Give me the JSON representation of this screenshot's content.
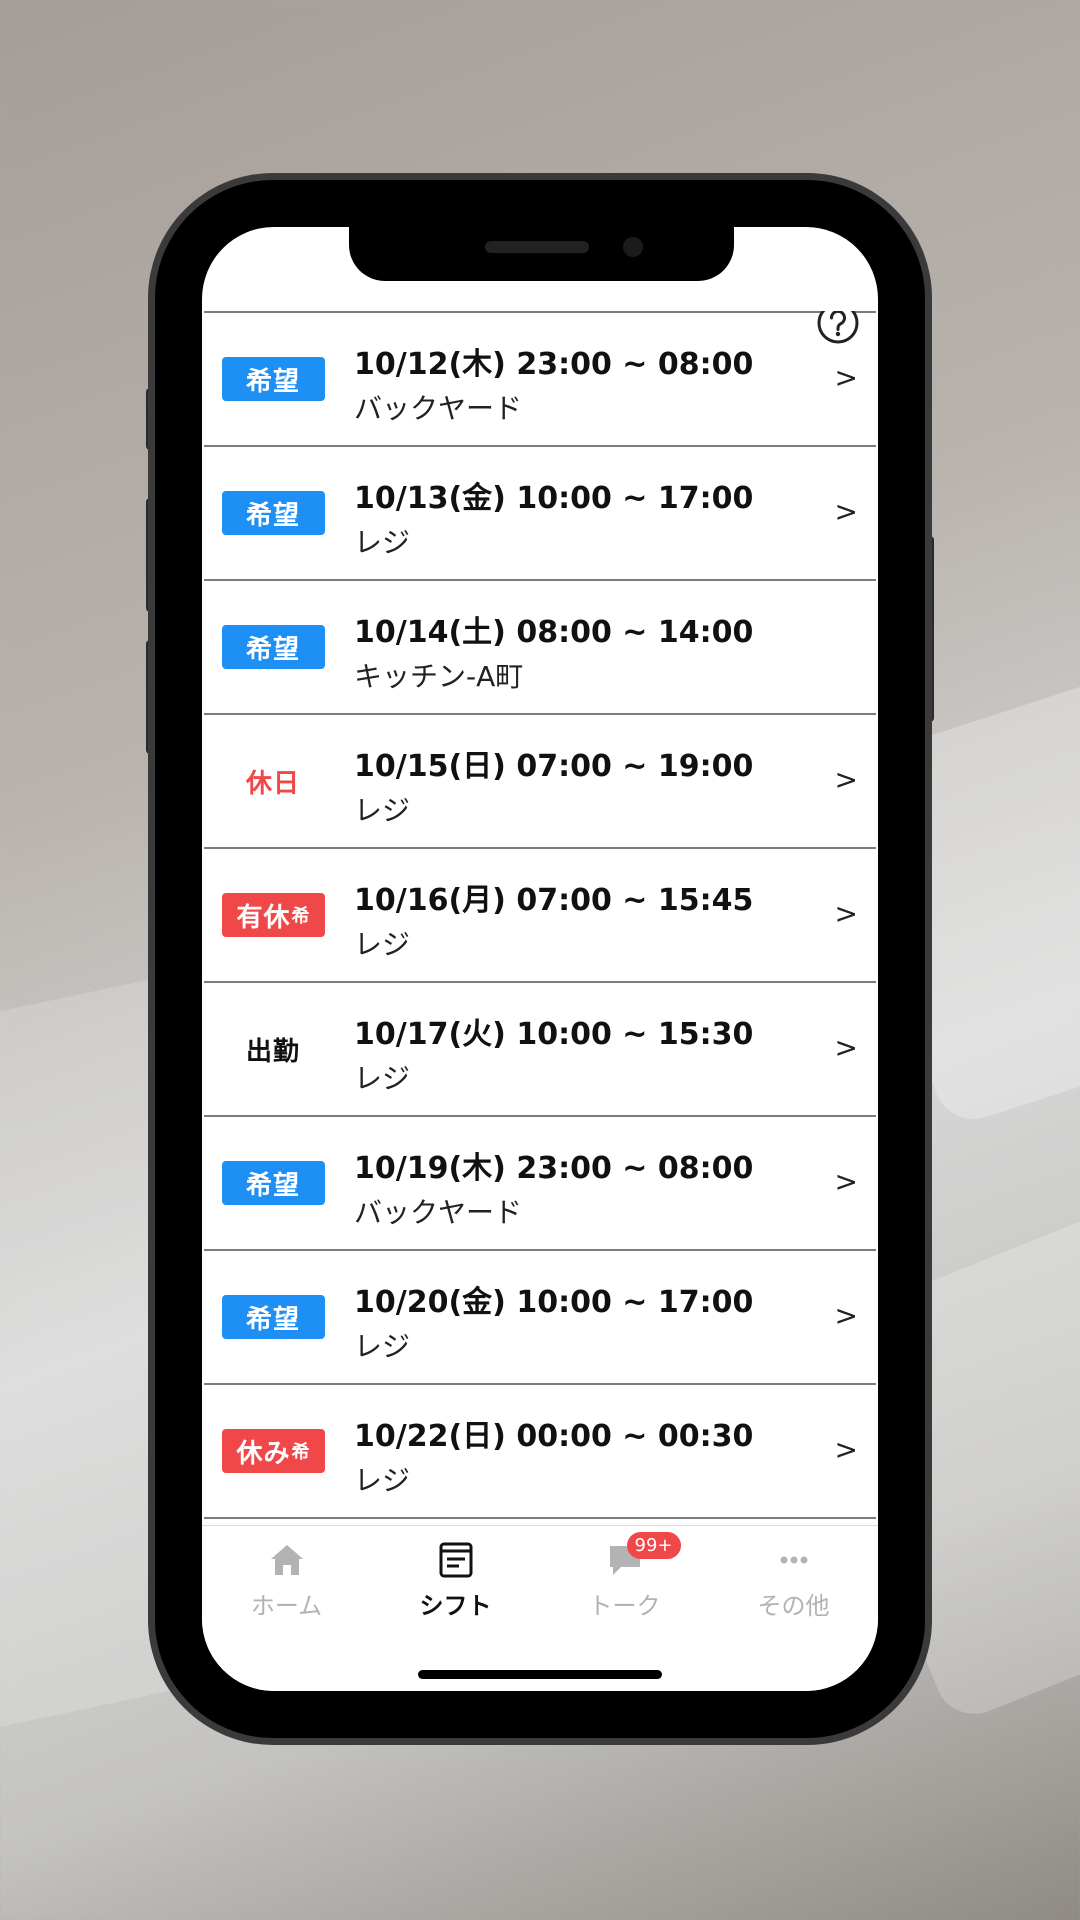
{
  "shifts": [
    {
      "badge": "希望",
      "badge_small": "",
      "style": "blue",
      "time": "10/12(木) 23:00 ~ 08:00",
      "location": "バックヤード",
      "chevron": ">"
    },
    {
      "badge": "希望",
      "badge_small": "",
      "style": "blue",
      "time": "10/13(金) 10:00 ~ 17:00",
      "location": "レジ",
      "chevron": ">"
    },
    {
      "badge": "希望",
      "badge_small": "",
      "style": "blue",
      "time": "10/14(土) 08:00 ~ 14:00",
      "location": "キッチン-A町",
      "chevron": ""
    },
    {
      "badge": "休日",
      "badge_small": "",
      "style": "red-text",
      "time": "10/15(日) 07:00 ~ 19:00",
      "location": "レジ",
      "chevron": ">"
    },
    {
      "badge": "有休",
      "badge_small": "希",
      "style": "red",
      "time": "10/16(月) 07:00 ~ 15:45",
      "location": "レジ",
      "chevron": ">"
    },
    {
      "badge": "出勤",
      "badge_small": "",
      "style": "plain",
      "time": "10/17(火) 10:00 ~ 15:30",
      "location": "レジ",
      "chevron": ">"
    },
    {
      "badge": "希望",
      "badge_small": "",
      "style": "blue",
      "time": "10/19(木) 23:00 ~ 08:00",
      "location": "バックヤード",
      "chevron": ">"
    },
    {
      "badge": "希望",
      "badge_small": "",
      "style": "blue",
      "time": "10/20(金) 10:00 ~ 17:00",
      "location": "レジ",
      "chevron": ">"
    },
    {
      "badge": "休み",
      "badge_small": "希",
      "style": "red",
      "time": "10/22(日) 00:00 ~ 00:30",
      "location": "レジ",
      "chevron": ">"
    }
  ],
  "tabs": [
    {
      "label": "ホーム",
      "icon": "home-icon",
      "active": false
    },
    {
      "label": "シフト",
      "icon": "shift-icon",
      "active": true
    },
    {
      "label": "トーク",
      "icon": "chat-icon",
      "active": false,
      "badge": "99+"
    },
    {
      "label": "その他",
      "icon": "more-icon",
      "active": false
    }
  ],
  "colors": {
    "accent_blue": "#1e90f5",
    "accent_red": "#f04848",
    "tab_inactive": "#b3b3b3"
  },
  "help_icon": "question-circle-icon"
}
